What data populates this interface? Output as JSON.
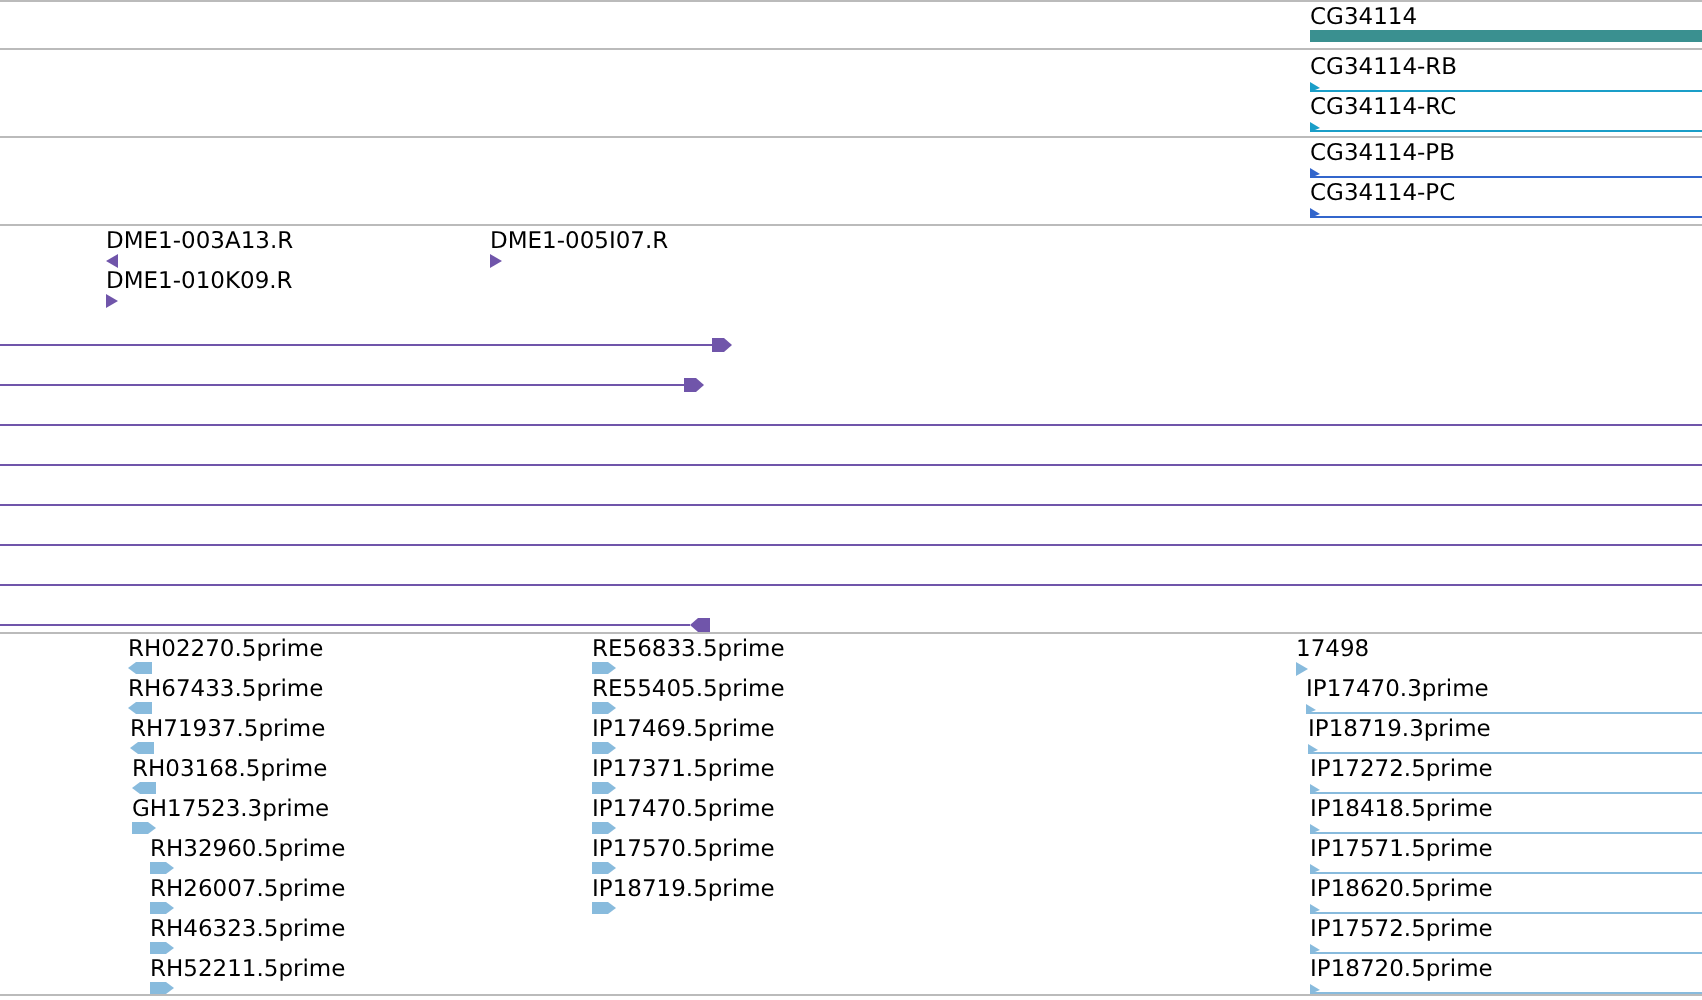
{
  "tracks": [
    {
      "features": [
        {
          "label": "CG34114",
          "kind": "bar"
        }
      ]
    },
    {
      "features": [
        {
          "label": "CG34114-RB",
          "kind": "transcript",
          "reverse": false
        },
        {
          "label": "CG34114-RC",
          "kind": "transcript",
          "reverse": false
        }
      ]
    },
    {
      "features": [
        {
          "label": "CG34114-PB",
          "kind": "transcript",
          "reverse": false
        },
        {
          "label": "CG34114-PC",
          "kind": "transcript",
          "reverse": false
        }
      ]
    },
    {
      "features": [
        {
          "label": "DME1-003A13.R",
          "kind": "tick",
          "reverse": true
        },
        {
          "label": "DME1-005I07.R",
          "kind": "tick",
          "reverse": false
        },
        {
          "label": "DME1-010K09.R",
          "kind": "tick",
          "reverse": false
        },
        {
          "kind": "read",
          "reverse": false
        },
        {
          "kind": "read",
          "reverse": false
        },
        {
          "kind": "line"
        },
        {
          "kind": "line"
        },
        {
          "kind": "line"
        },
        {
          "kind": "line"
        },
        {
          "kind": "line"
        },
        {
          "kind": "read",
          "reverse": true
        }
      ]
    },
    {
      "features": [
        {
          "label": "RH02270.5prime",
          "kind": "est",
          "reverse": true
        },
        {
          "label": "RH67433.5prime",
          "kind": "est",
          "reverse": true
        },
        {
          "label": "RH71937.5prime",
          "kind": "est",
          "reverse": true
        },
        {
          "label": "RH03168.5prime",
          "kind": "est",
          "reverse": true
        },
        {
          "label": "GH17523.3prime",
          "kind": "est",
          "reverse": false
        },
        {
          "label": "RH32960.5prime",
          "kind": "est",
          "reverse": false
        },
        {
          "label": "RH26007.5prime",
          "kind": "est",
          "reverse": false
        },
        {
          "label": "RH46323.5prime",
          "kind": "est",
          "reverse": false
        },
        {
          "label": "RH52211.5prime",
          "kind": "est",
          "reverse": false
        },
        {
          "label": "RE56833.5prime",
          "kind": "est",
          "reverse": false
        },
        {
          "label": "RE55405.5prime",
          "kind": "est",
          "reverse": false
        },
        {
          "label": "IP17469.5prime",
          "kind": "est",
          "reverse": false
        },
        {
          "label": "IP17371.5prime",
          "kind": "est",
          "reverse": false
        },
        {
          "label": "IP17470.5prime",
          "kind": "est",
          "reverse": false
        },
        {
          "label": "IP17570.5prime",
          "kind": "est",
          "reverse": false
        },
        {
          "label": "IP18719.5prime",
          "kind": "est",
          "reverse": false
        },
        {
          "label": "17498",
          "kind": "tick",
          "reverse": false
        },
        {
          "label": "IP17470.3prime",
          "kind": "transcript",
          "reverse": false
        },
        {
          "label": "IP18719.3prime",
          "kind": "transcript",
          "reverse": false
        },
        {
          "label": "IP17272.5prime",
          "kind": "transcript",
          "reverse": false
        },
        {
          "label": "IP18418.5prime",
          "kind": "transcript",
          "reverse": false
        },
        {
          "label": "IP17571.5prime",
          "kind": "transcript",
          "reverse": false
        },
        {
          "label": "IP18620.5prime",
          "kind": "transcript",
          "reverse": false
        },
        {
          "label": "IP17572.5prime",
          "kind": "transcript",
          "reverse": false
        },
        {
          "label": "IP18720.5prime",
          "kind": "transcript",
          "reverse": false
        }
      ]
    }
  ]
}
